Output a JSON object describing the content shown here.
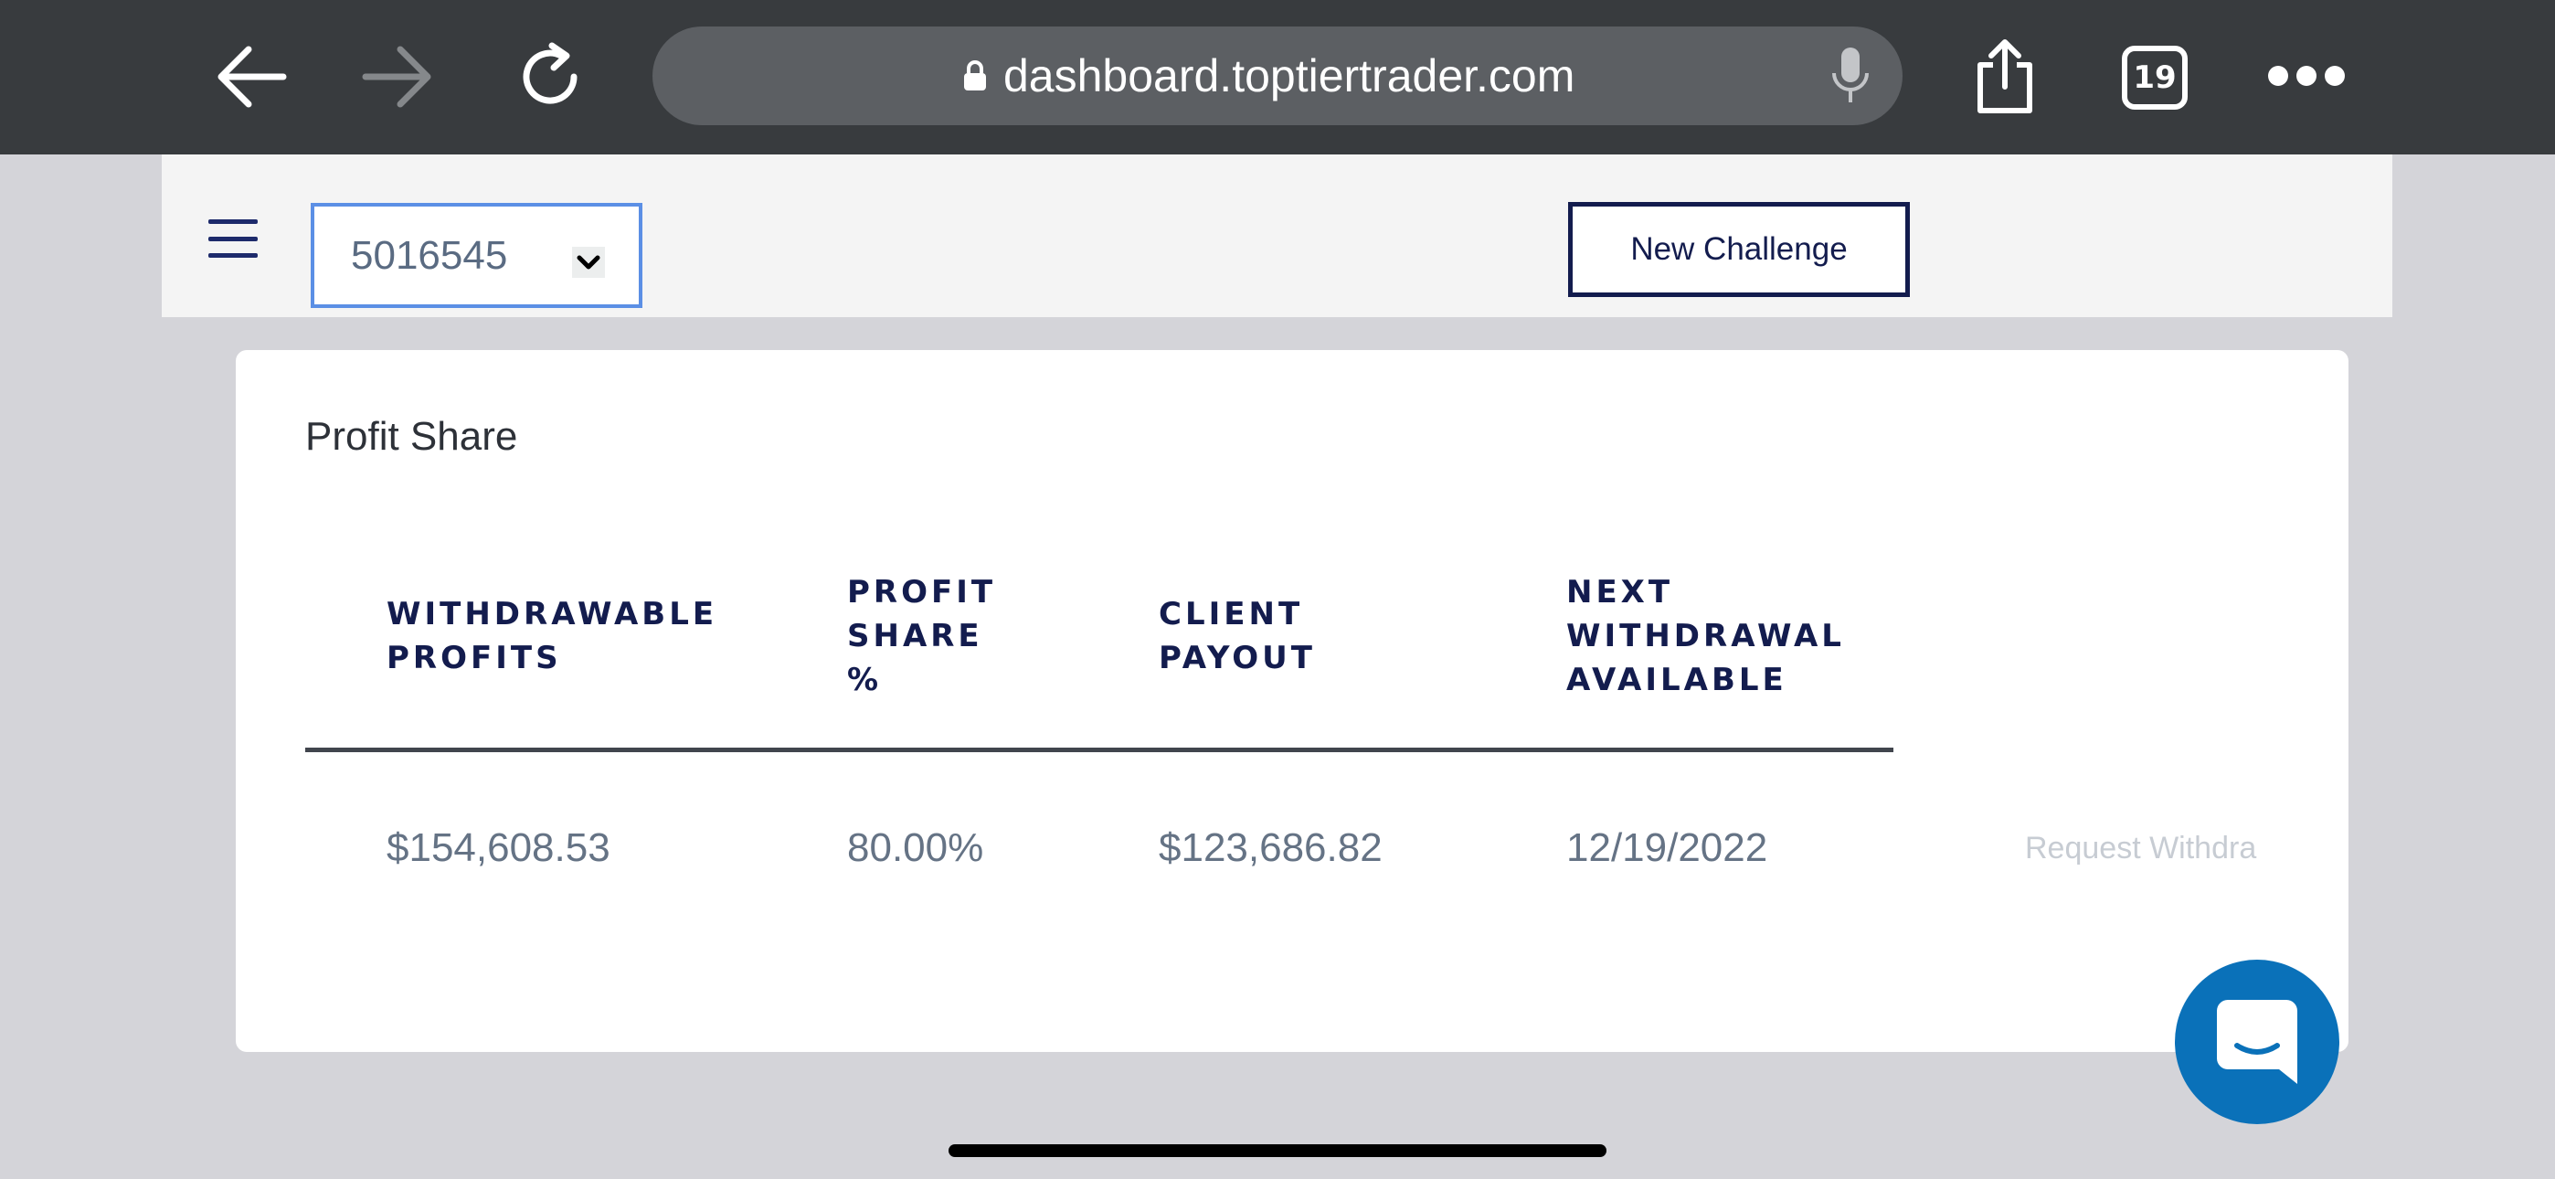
{
  "browser": {
    "url": "dashboard.toptiertrader.com",
    "tab_count": "19",
    "icons": [
      "back-icon",
      "forward-icon",
      "reload-icon",
      "lock-icon",
      "microphone-icon",
      "share-icon",
      "tabs-icon",
      "more-icon"
    ]
  },
  "header": {
    "account_number": "5016545",
    "new_challenge_label": "New Challenge"
  },
  "card": {
    "title": "Profit Share",
    "columns": [
      [
        "WITHDRAWABLE",
        "PROFITS"
      ],
      [
        "PROFIT",
        "SHARE",
        "%"
      ],
      [
        "CLIENT",
        "PAYOUT"
      ],
      [
        "NEXT",
        "WITHDRAWAL",
        "AVAILABLE"
      ]
    ],
    "row": {
      "withdrawable_profits": "$154,608.53",
      "profit_share_pct": "80.00%",
      "client_payout": "$123,686.82",
      "next_withdrawal": "12/19/2022"
    },
    "request_label": "Request Withdra"
  },
  "colors": {
    "navy": "#131c4e",
    "chat_blue": "#0a71b9",
    "select_border": "#5b8fe5"
  }
}
